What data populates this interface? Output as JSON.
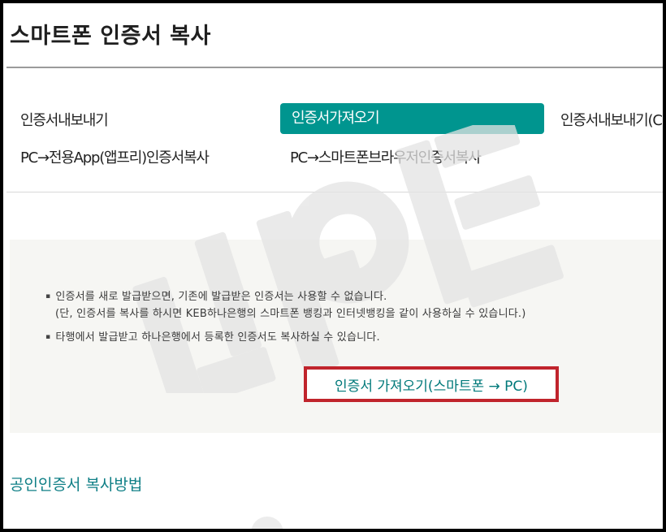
{
  "page": {
    "title": "스마트폰 인증서 복사"
  },
  "tabs": [
    {
      "label": "인증서내보내기",
      "active": false
    },
    {
      "label": "인증서가져오기",
      "active": true
    },
    {
      "label": "인증서내보내기(C",
      "active": false
    },
    {
      "label": "PC→전용App(앱프리)인증서복사",
      "active": false
    },
    {
      "label": "PC→스마트폰브라우저인증서복사",
      "active": false
    }
  ],
  "notices": {
    "item1": "인증서를 새로 발급받으면, 기존에 발급받은 인증서는 사용할 수 없습니다.",
    "item1_sub": "(단, 인증서를 복사를 하시면 KEB하나은행의 스마트폰 뱅킹과 인터넷뱅킹을 같이 사용하실 수 있습니다.)",
    "item2": "타행에서 발급받고 하나은행에서 등록한 인증서도 복사하실 수 있습니다.",
    "bullet": "▪"
  },
  "import_button": {
    "label": "인증서 가져오기(스마트폰 → PC)"
  },
  "section": {
    "link_label": "공인인증서 복사방법"
  },
  "watermark": {
    "text": "나이팁"
  },
  "colors": {
    "accent_teal": "#00958f",
    "link_teal": "#0f7f86",
    "highlight_red": "#c0242c",
    "info_bg": "#f6f6f3"
  }
}
